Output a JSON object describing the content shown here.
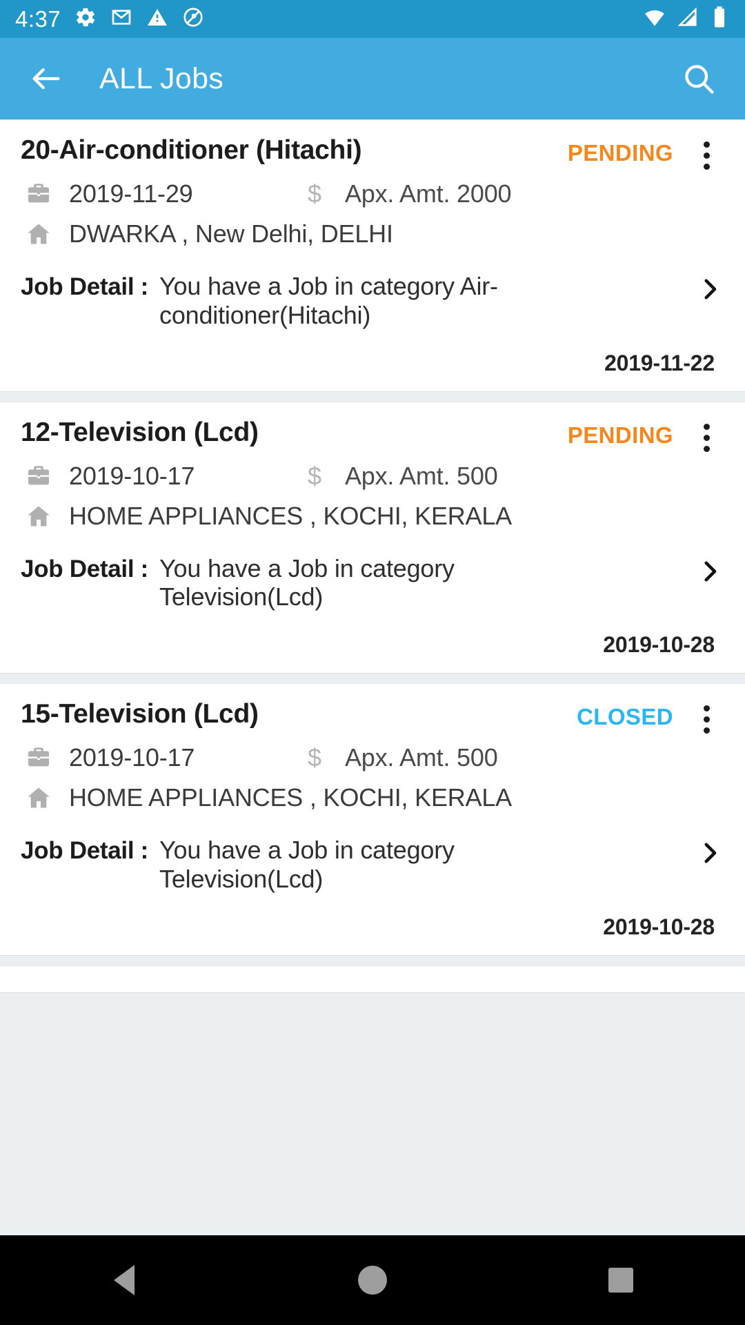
{
  "statusbar": {
    "time": "4:37",
    "icons": [
      "gear-icon",
      "gmail-icon",
      "warning-icon",
      "do-not-disturb-icon"
    ],
    "right_icons": [
      "wifi-icon",
      "cellular-signal-icon",
      "battery-icon"
    ],
    "background": "#2196c9"
  },
  "appbar": {
    "title": "ALL Jobs",
    "back_icon": "back-arrow-icon",
    "search_icon": "search-icon",
    "background": "#42abe0"
  },
  "labels": {
    "job_detail": "Job Detail :",
    "amount_prefix": "Apx. Amt."
  },
  "colors": {
    "pending": "#f5871f",
    "closed": "#29b6f6",
    "accent": "#42abe0"
  },
  "jobs": [
    {
      "title": "20-Air-conditioner (Hitachi)",
      "status": "PENDING",
      "status_kind": "pending",
      "date": "2019-11-29",
      "amount": "Apx. Amt. 2000",
      "address": "DWARKA , New Delhi, DELHI",
      "detail_label": "Job Detail :",
      "detail": "You have a Job in category Air-conditioner(Hitachi)",
      "posted_date": "2019-11-22"
    },
    {
      "title": "12-Television (Lcd)",
      "status": "PENDING",
      "status_kind": "pending",
      "date": "2019-10-17",
      "amount": "Apx. Amt. 500",
      "address": "HOME APPLIANCES , KOCHI, KERALA",
      "detail_label": "Job Detail :",
      "detail": "You have a Job in category Television(Lcd)",
      "posted_date": "2019-10-28"
    },
    {
      "title": "15-Television (Lcd)",
      "status": "CLOSED",
      "status_kind": "closed",
      "date": "2019-10-17",
      "amount": "Apx. Amt. 500",
      "address": "HOME APPLIANCES , KOCHI, KERALA",
      "detail_label": "Job Detail :",
      "detail": "You have a Job in category Television(Lcd)",
      "posted_date": "2019-10-28"
    }
  ],
  "navbar": {
    "back": "nav-back-icon",
    "home": "nav-home-icon",
    "recents": "nav-recents-icon"
  }
}
